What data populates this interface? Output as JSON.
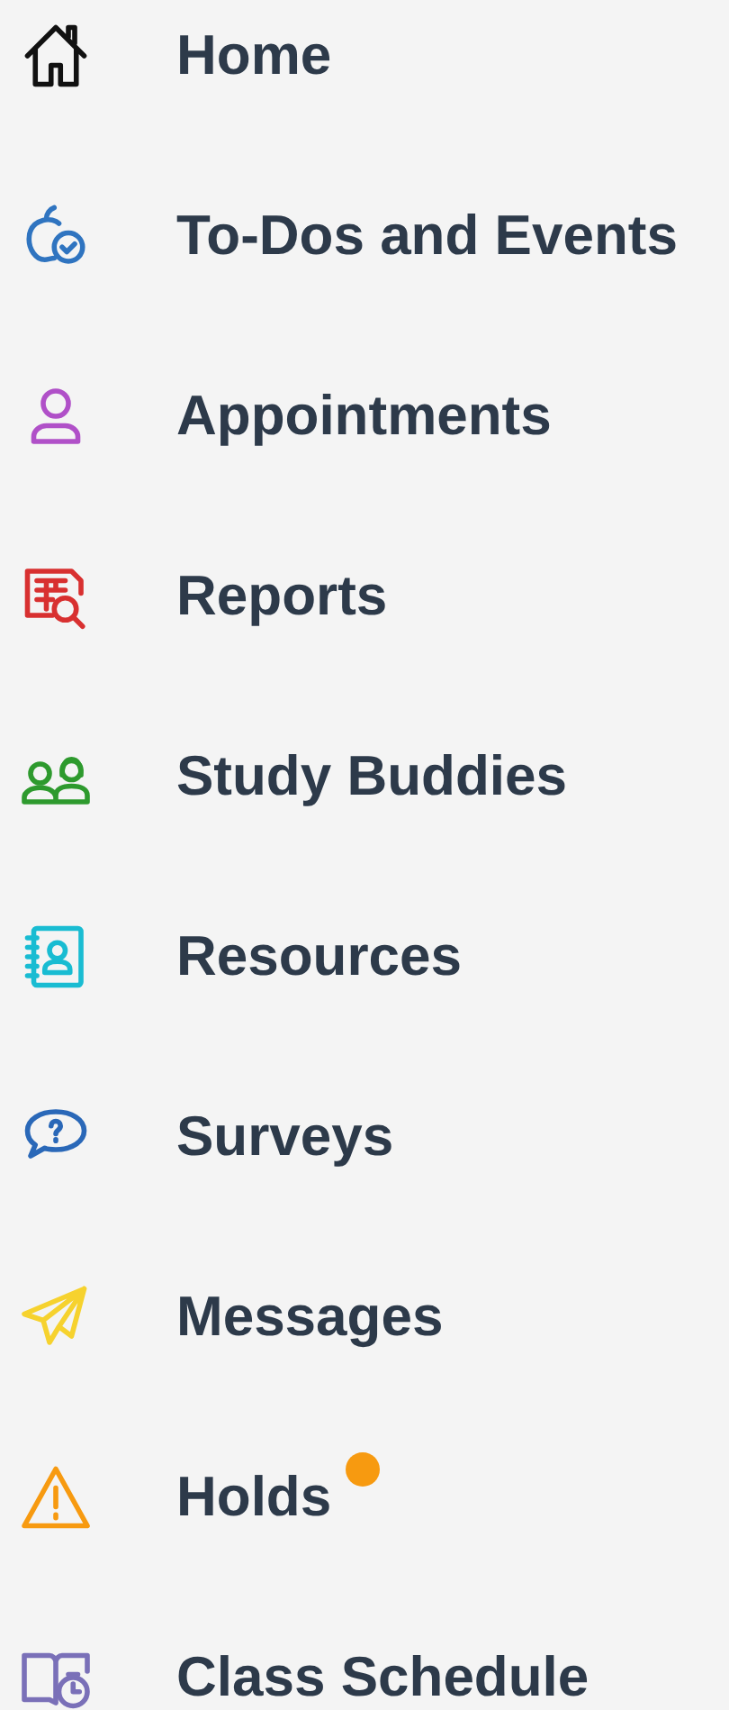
{
  "nav_menu": {
    "items": [
      {
        "label": "Home",
        "color": "#111111",
        "alert": false
      },
      {
        "label": "To-Dos and Events",
        "color": "#2f74c0",
        "alert": false
      },
      {
        "label": "Appointments",
        "color": "#b050c8",
        "alert": false
      },
      {
        "label": "Reports",
        "color": "#d83030",
        "alert": false
      },
      {
        "label": "Study Buddies",
        "color": "#2e9a2e",
        "alert": false
      },
      {
        "label": "Resources",
        "color": "#19bcd2",
        "alert": false
      },
      {
        "label": "Surveys",
        "color": "#2a68b8",
        "alert": false
      },
      {
        "label": "Messages",
        "color": "#f6d22e",
        "alert": false
      },
      {
        "label": "Holds",
        "color": "#f79a10",
        "alert": true
      },
      {
        "label": "Class Schedule",
        "color": "#7a70b8",
        "alert": false
      }
    ]
  }
}
